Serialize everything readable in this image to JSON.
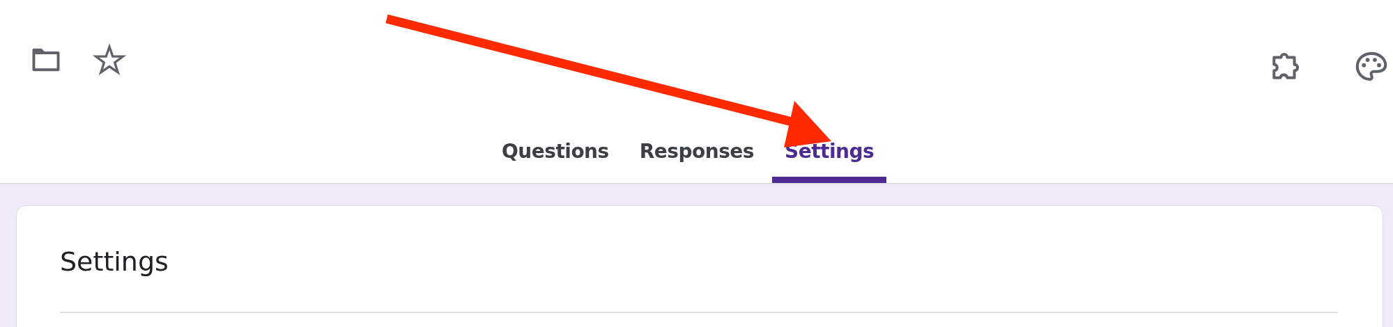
{
  "tabs": [
    {
      "label": "Questions",
      "selected": false
    },
    {
      "label": "Responses",
      "selected": false
    },
    {
      "label": "Settings",
      "selected": true
    }
  ],
  "card": {
    "title": "Settings"
  }
}
